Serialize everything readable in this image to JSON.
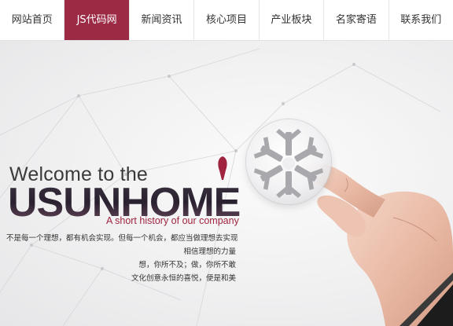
{
  "nav": {
    "items": [
      {
        "label": "网站首页",
        "active": false
      },
      {
        "label": "JS代码网",
        "active": true
      },
      {
        "label": "新闻资讯",
        "active": false
      },
      {
        "label": "核心项目",
        "active": false
      },
      {
        "label": "产业板块",
        "active": false
      },
      {
        "label": "名家寄语",
        "active": false
      },
      {
        "label": "联系我们",
        "active": false
      }
    ],
    "active_color": "#9c2a45"
  },
  "hero": {
    "welcome": "Welcome to the",
    "brand": "USUNHOME",
    "tagline": "A short history of our company",
    "description": [
      "不是每一个理想，都有机会实现。但每一个机会，都应当做理想去实现",
      "相信理想的力量",
      "想，你所不及；做，你所不敢",
      "文化创意永恒的喜悦，便是和美"
    ],
    "accent_color": "#a0243f",
    "icons": [
      "drop-mark-icon",
      "snowflake-logo-icon",
      "hand-image"
    ]
  }
}
